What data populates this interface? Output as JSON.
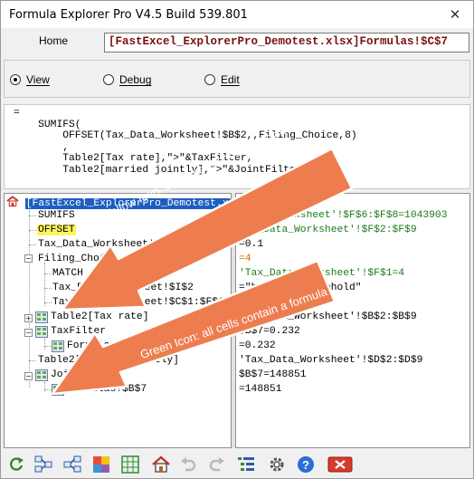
{
  "window": {
    "title": "Formula Explorer Pro V4.5 Build 539.801",
    "close_glyph": "✕"
  },
  "home": {
    "label": "Home",
    "address": "[FastExcel_ExplorerPro_Demotest.xlsx]Formulas!$C$7"
  },
  "modes": [
    {
      "label": "View",
      "selected": true
    },
    {
      "label": "Debug",
      "selected": false
    },
    {
      "label": "Edit",
      "selected": false
    }
  ],
  "formula_text": "=\n    SUMIFS(\n        OFFSET(Tax_Data_Worksheet!$B$2,,Filing_Choice,8)\n        ,\n        Table2[Tax rate],\">\"&TaxFilter,\n        Table2[married jointly],\">\"&JointFilter)",
  "tree": {
    "root": "[FastExcel_ExplorerPro_Demotest.xlsx]",
    "nodes": [
      "SUMIFS",
      "OFFSET",
      "Tax_Data_Worksheet!$B$2",
      "Filing_Choice",
      "MATCH",
      "Tax_Data_Worksheet!$I$2",
      "Tax_Data_Worksheet!$C$1:$F$1",
      "Table2[Tax rate]",
      "TaxFilter",
      "Formulas!$B$6",
      "Table2[married jointly]",
      "JointFilter",
      "Formulas!$B$7"
    ]
  },
  "values": [
    "_Data_Worksheet'!$F$6:$F$8=1043903",
    "Tax_Data_Worksheet'!$F$2:$F$9",
    "=0.1",
    "=4",
    "'Tax_Data_Worksheet'!$F$1=4",
    "=\"head of household\"",
    "",
    "Tax_Data_Worksheet'!$B$2:$B$9",
    "$B$7=0.232",
    "=0.232",
    "'Tax_Data_Worksheet'!$D$2:$D$9",
    "$B$7=148851",
    "=148851"
  ],
  "callouts": [
    "Yellow Icon: some cells contain a formula",
    "Green Icon: all cells contain a formula"
  ],
  "toolbar": [
    "refresh-icon",
    "trace-precedents-icon",
    "trace-dependents-icon",
    "color-grid-icon",
    "map-grid-icon",
    "home-icon",
    "undo-icon",
    "redo-icon",
    "list-tree-icon",
    "settings-icon",
    "help-icon",
    "close-red-icon"
  ],
  "colors": {
    "accent": "#1e5dbf",
    "address_text": "#7a1010",
    "callout": "#ed7d4f",
    "yellow_node": "#fff35c"
  }
}
